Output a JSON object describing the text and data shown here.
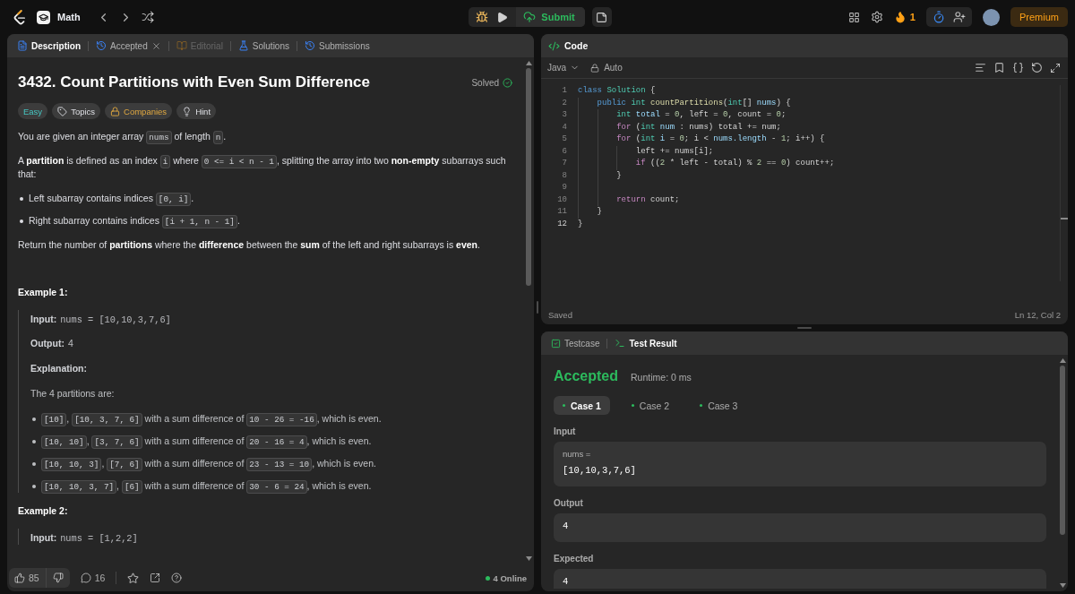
{
  "top_bar": {
    "problem_list": "Math",
    "submit_label": "Submit",
    "streak": "1",
    "premium_label": "Premium"
  },
  "description_panel": {
    "tabs": [
      {
        "kind": "description",
        "label": "Description",
        "selected": true,
        "disabled": false,
        "closable": false
      },
      {
        "kind": "accepted",
        "label": "Accepted",
        "selected": false,
        "disabled": false,
        "closable": true
      },
      {
        "kind": "editorial",
        "label": "Editorial",
        "selected": false,
        "disabled": true,
        "closable": false
      },
      {
        "kind": "solutions",
        "label": "Solutions",
        "selected": false,
        "disabled": false,
        "closable": false
      },
      {
        "kind": "submissions",
        "label": "Submissions",
        "selected": false,
        "disabled": false,
        "closable": false
      }
    ],
    "title": "3432. Count Partitions with Even Sum Difference",
    "status": "Solved",
    "tags": [
      {
        "kind": "difficulty",
        "label": "Easy"
      },
      {
        "kind": "topics",
        "label": "Topics"
      },
      {
        "kind": "companies",
        "label": "Companies"
      },
      {
        "kind": "hint",
        "label": "Hint"
      }
    ],
    "content": [
      {
        "kind": "paragraph",
        "segments": [
          {
            "kind": "text",
            "text": "You are given an integer array "
          },
          {
            "kind": "code",
            "text": "nums"
          },
          {
            "kind": "text",
            "text": " of length "
          },
          {
            "kind": "code",
            "text": "n"
          },
          {
            "kind": "text",
            "text": "."
          }
        ]
      },
      {
        "kind": "paragraph",
        "segments": [
          {
            "kind": "text",
            "text": "A **partition** is defined as an index "
          },
          {
            "kind": "code",
            "text": "i"
          },
          {
            "kind": "text",
            "text": " where "
          },
          {
            "kind": "code",
            "text": "0 <= i < n - 1"
          },
          {
            "kind": "text",
            "text": ", splitting the array into two **non-empty** subarrays such that:"
          }
        ]
      },
      {
        "kind": "bullets",
        "items": [
          {
            "segments": [
              {
                "kind": "text",
                "text": "Left subarray contains indices "
              },
              {
                "kind": "code",
                "text": "[0, i]"
              },
              {
                "kind": "text",
                "text": "."
              }
            ]
          },
          {
            "segments": [
              {
                "kind": "text",
                "text": "Right subarray contains indices "
              },
              {
                "kind": "code",
                "text": "[i + 1, n - 1]"
              },
              {
                "kind": "text",
                "text": "."
              }
            ]
          }
        ]
      },
      {
        "kind": "paragraph",
        "segments": [
          {
            "kind": "text",
            "text": "Return the number of **partitions** where the **difference** between the **sum** of the left and right subarrays is **even**."
          }
        ]
      },
      {
        "kind": "example",
        "title": "Example 1:",
        "lines": [
          {
            "kind": "io",
            "label": "Input:",
            "value": "nums = [10,10,3,7,6]",
            "code": true
          },
          {
            "kind": "io",
            "label": "Output:",
            "value": "4",
            "code": false
          },
          {
            "kind": "heading",
            "text": "Explanation:"
          },
          {
            "kind": "paragraph",
            "segments": [
              {
                "kind": "text",
                "text": "The 4 partitions are:"
              }
            ]
          },
          {
            "kind": "bullets",
            "items": [
              {
                "segments": [
                  {
                    "kind": "code",
                    "text": "[10]"
                  },
                  {
                    "kind": "text",
                    "text": ", "
                  },
                  {
                    "kind": "code",
                    "text": "[10, 3, 7, 6]"
                  },
                  {
                    "kind": "text",
                    "text": " with a sum difference of "
                  },
                  {
                    "kind": "code",
                    "text": "10 - 26 = -16"
                  },
                  {
                    "kind": "text",
                    "text": ", which is even."
                  }
                ]
              },
              {
                "segments": [
                  {
                    "kind": "code",
                    "text": "[10, 10]"
                  },
                  {
                    "kind": "text",
                    "text": ", "
                  },
                  {
                    "kind": "code",
                    "text": "[3, 7, 6]"
                  },
                  {
                    "kind": "text",
                    "text": " with a sum difference of "
                  },
                  {
                    "kind": "code",
                    "text": "20 - 16 = 4"
                  },
                  {
                    "kind": "text",
                    "text": ", which is even."
                  }
                ]
              },
              {
                "segments": [
                  {
                    "kind": "code",
                    "text": "[10, 10, 3]"
                  },
                  {
                    "kind": "text",
                    "text": ", "
                  },
                  {
                    "kind": "code",
                    "text": "[7, 6]"
                  },
                  {
                    "kind": "text",
                    "text": " with a sum difference of "
                  },
                  {
                    "kind": "code",
                    "text": "23 - 13 = 10"
                  },
                  {
                    "kind": "text",
                    "text": ", which is even."
                  }
                ]
              },
              {
                "segments": [
                  {
                    "kind": "code",
                    "text": "[10, 10, 3, 7]"
                  },
                  {
                    "kind": "text",
                    "text": ", "
                  },
                  {
                    "kind": "code",
                    "text": "[6]"
                  },
                  {
                    "kind": "text",
                    "text": " with a sum difference of "
                  },
                  {
                    "kind": "code",
                    "text": "30 - 6 = 24"
                  },
                  {
                    "kind": "text",
                    "text": ", which is even."
                  }
                ]
              }
            ]
          }
        ]
      },
      {
        "kind": "example",
        "title": "Example 2:",
        "lines": [
          {
            "kind": "io",
            "label": "Input:",
            "value": "nums = [1,2,2]",
            "code": true
          }
        ]
      }
    ],
    "footer": {
      "likes": "85",
      "comments": "16",
      "online": "4 Online"
    }
  },
  "code_panel": {
    "title": "Code",
    "language": "Java",
    "mode": "Auto",
    "lines": [
      {
        "number": "1",
        "current": false,
        "tokens": [
          {
            "kind": "keyword",
            "text": "class "
          },
          {
            "kind": "type",
            "text": "Solution"
          },
          {
            "kind": "plain",
            "text": " {"
          }
        ]
      },
      {
        "number": "2",
        "current": false,
        "tokens": [
          {
            "kind": "keyword",
            "text": "    public "
          },
          {
            "kind": "type",
            "text": "int "
          },
          {
            "kind": "function",
            "text": "countPartitions"
          },
          {
            "kind": "plain",
            "text": "("
          },
          {
            "kind": "type",
            "text": "int"
          },
          {
            "kind": "plain",
            "text": "[] "
          },
          {
            "kind": "variable",
            "text": "nums"
          },
          {
            "kind": "plain",
            "text": ") {"
          }
        ]
      },
      {
        "number": "3",
        "current": false,
        "tokens": [
          {
            "kind": "type",
            "text": "        int "
          },
          {
            "kind": "variable",
            "text": "total"
          },
          {
            "kind": "plain",
            "text": " = "
          },
          {
            "kind": "number",
            "text": "0"
          },
          {
            "kind": "plain",
            "text": ", left = "
          },
          {
            "kind": "number",
            "text": "0"
          },
          {
            "kind": "plain",
            "text": ", count = "
          },
          {
            "kind": "number",
            "text": "0"
          },
          {
            "kind": "plain",
            "text": ";"
          }
        ]
      },
      {
        "number": "4",
        "current": false,
        "tokens": [
          {
            "kind": "control",
            "text": "        for "
          },
          {
            "kind": "plain",
            "text": "("
          },
          {
            "kind": "type",
            "text": "int "
          },
          {
            "kind": "variable",
            "text": "num"
          },
          {
            "kind": "plain",
            "text": " : nums) total += num;"
          }
        ]
      },
      {
        "number": "5",
        "current": false,
        "tokens": [
          {
            "kind": "control",
            "text": "        for "
          },
          {
            "kind": "plain",
            "text": "("
          },
          {
            "kind": "type",
            "text": "int "
          },
          {
            "kind": "variable",
            "text": "i"
          },
          {
            "kind": "plain",
            "text": " = "
          },
          {
            "kind": "number",
            "text": "0"
          },
          {
            "kind": "plain",
            "text": "; i < "
          },
          {
            "kind": "variable",
            "text": "nums.length"
          },
          {
            "kind": "plain",
            "text": " - "
          },
          {
            "kind": "number",
            "text": "1"
          },
          {
            "kind": "plain",
            "text": "; i++) {"
          }
        ]
      },
      {
        "number": "6",
        "current": false,
        "tokens": [
          {
            "kind": "plain",
            "text": "            left += nums[i];"
          }
        ]
      },
      {
        "number": "7",
        "current": false,
        "tokens": [
          {
            "kind": "control",
            "text": "            if "
          },
          {
            "kind": "plain",
            "text": "(("
          },
          {
            "kind": "number",
            "text": "2"
          },
          {
            "kind": "plain",
            "text": " * left - total) % "
          },
          {
            "kind": "number",
            "text": "2"
          },
          {
            "kind": "plain",
            "text": " == "
          },
          {
            "kind": "number",
            "text": "0"
          },
          {
            "kind": "plain",
            "text": ") count++;"
          }
        ]
      },
      {
        "number": "8",
        "current": false,
        "tokens": [
          {
            "kind": "plain",
            "text": "        }"
          }
        ]
      },
      {
        "number": "9",
        "current": false
      },
      {
        "number": "10",
        "current": false,
        "tokens": [
          {
            "kind": "control",
            "text": "        return "
          },
          {
            "kind": "plain",
            "text": "count;"
          }
        ]
      },
      {
        "number": "11",
        "current": false,
        "tokens": [
          {
            "kind": "plain",
            "text": "    }"
          }
        ]
      },
      {
        "number": "12",
        "current": true,
        "tokens": [
          {
            "kind": "plain",
            "text": "}"
          }
        ]
      }
    ],
    "status": "Saved",
    "cursor": "Ln 12, Col 2"
  },
  "result_panel": {
    "tabs": [
      {
        "kind": "testcase",
        "label": "Testcase",
        "selected": false
      },
      {
        "kind": "result",
        "label": "Test Result",
        "selected": true
      }
    ],
    "verdict": {
      "text": "Accepted",
      "passed": true
    },
    "runtime": "Runtime: 0 ms",
    "cases": [
      {
        "label": "Case 1",
        "selected": true,
        "passed": true
      },
      {
        "label": "Case 2",
        "selected": false,
        "passed": true
      },
      {
        "label": "Case 3",
        "selected": false,
        "passed": true
      }
    ],
    "sections": [
      {
        "label": "Input",
        "name": "nums =",
        "value": "[10,10,3,7,6]"
      },
      {
        "label": "Output",
        "value": "4"
      },
      {
        "label": "Expected",
        "value": "4"
      }
    ]
  }
}
